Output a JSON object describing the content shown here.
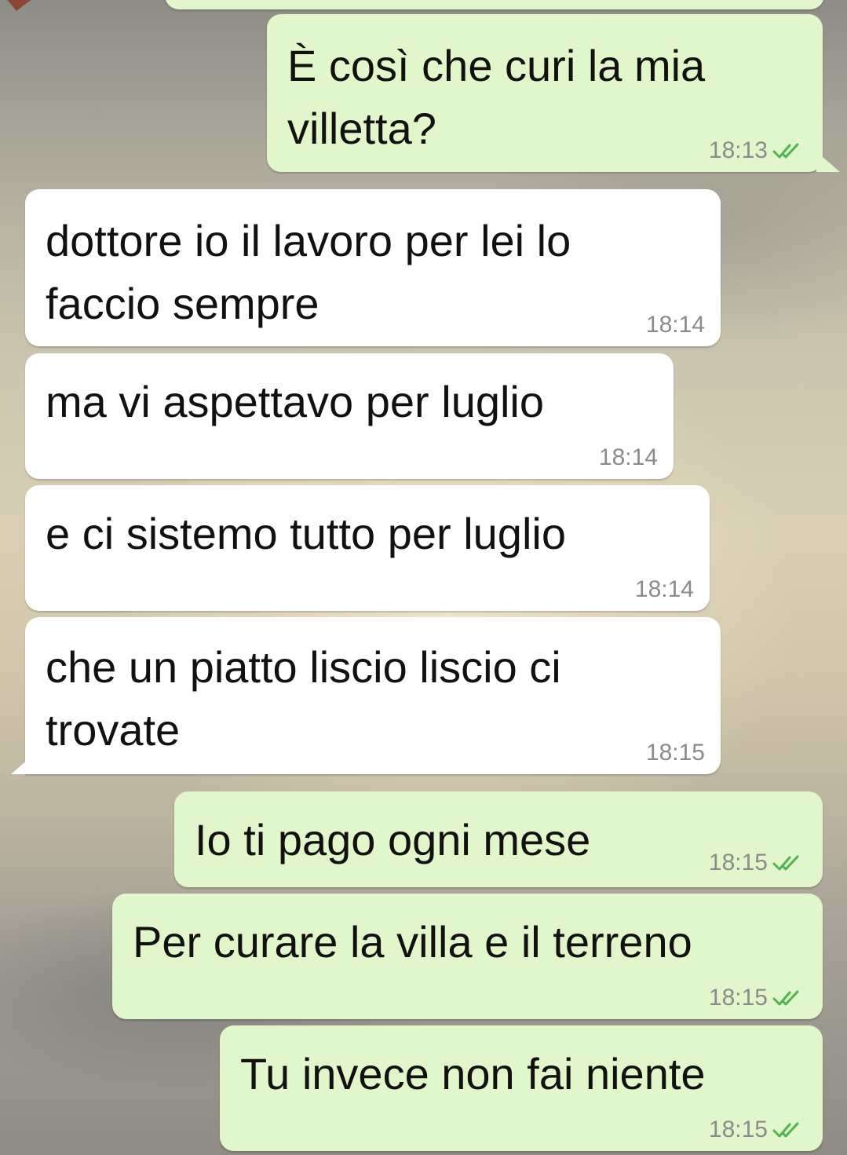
{
  "messages": [
    {
      "id": "m1",
      "direction": "outgoing",
      "lines": [
        "È così che curi la mia",
        "villetta?"
      ],
      "time": "18:13",
      "status": "read"
    },
    {
      "id": "m2",
      "direction": "incoming",
      "lines": [
        "dottore io il lavoro per lei lo",
        "faccio sempre"
      ],
      "time": "18:14"
    },
    {
      "id": "m3",
      "direction": "incoming",
      "lines": [
        "ma vi aspettavo per luglio"
      ],
      "time": "18:14"
    },
    {
      "id": "m4",
      "direction": "incoming",
      "lines": [
        "e ci sistemo tutto per luglio"
      ],
      "time": "18:14"
    },
    {
      "id": "m5",
      "direction": "incoming",
      "lines": [
        "che un piatto liscio liscio ci",
        "trovate"
      ],
      "time": "18:15"
    },
    {
      "id": "m6",
      "direction": "outgoing",
      "lines": [
        "Io ti pago ogni mese"
      ],
      "time": "18:15",
      "status": "read"
    },
    {
      "id": "m7",
      "direction": "outgoing",
      "lines": [
        "Per curare la villa e il terreno"
      ],
      "time": "18:15",
      "status": "read"
    },
    {
      "id": "m8",
      "direction": "outgoing",
      "lines": [
        "Tu invece non fai niente"
      ],
      "time": "18:15",
      "status": "read"
    }
  ],
  "colors": {
    "incoming_bubble": "#ffffff",
    "outgoing_bubble": "#e1f7cb",
    "read_ticks": "#4fb34f",
    "timestamp": "#8b8b8b"
  },
  "icons": {
    "read_receipt": "double-check-icon"
  }
}
